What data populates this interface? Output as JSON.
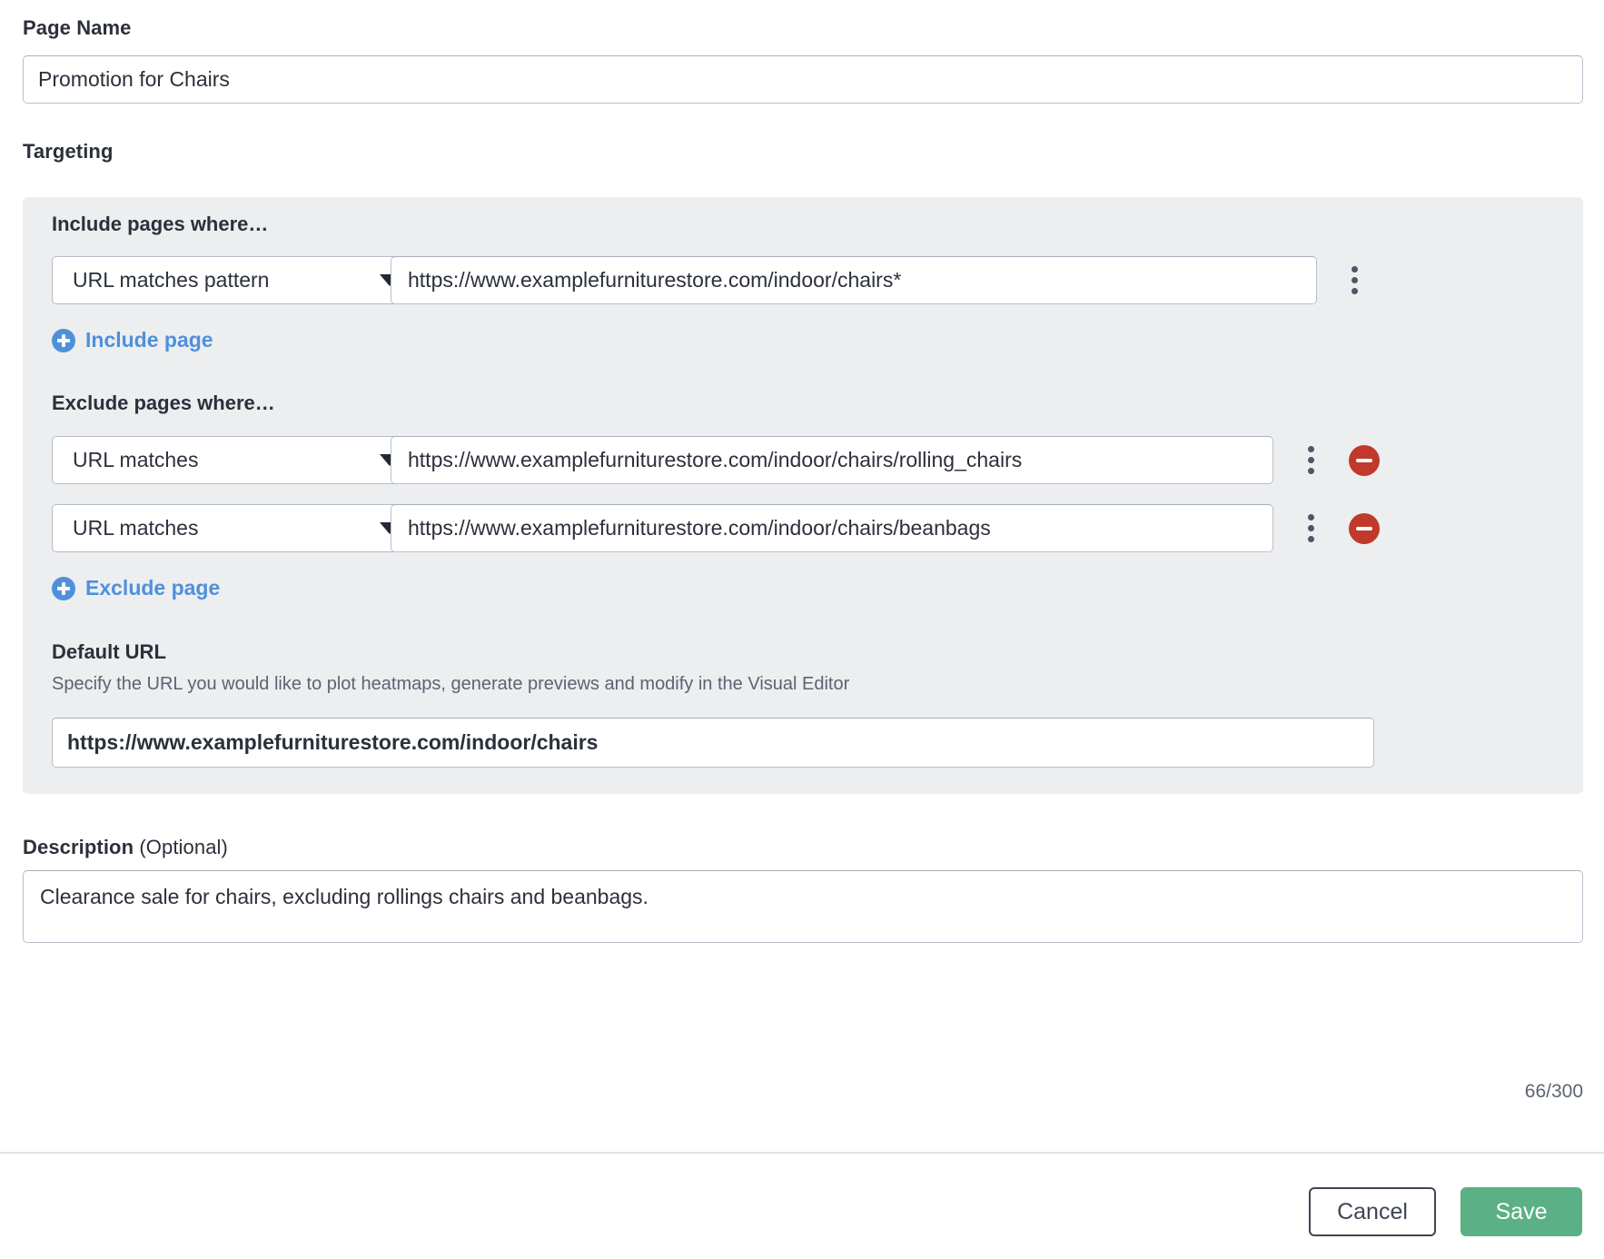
{
  "page_name": {
    "label": "Page Name",
    "value": "Promotion for Chairs"
  },
  "targeting": {
    "label": "Targeting",
    "include": {
      "heading": "Include pages where…",
      "rows": [
        {
          "condition": "URL matches pattern",
          "url": "https://www.examplefurniturestore.com/indoor/chairs*",
          "menu_icon": "kebab-menu-icon"
        }
      ],
      "add_label": "Include page",
      "add_icon": "plus-circle-icon"
    },
    "exclude": {
      "heading": "Exclude pages where…",
      "rows": [
        {
          "condition": "URL matches",
          "url": "https://www.examplefurniturestore.com/indoor/chairs/rolling_chairs",
          "menu_icon": "kebab-menu-icon",
          "remove_icon": "remove-circle-icon"
        },
        {
          "condition": "URL matches",
          "url": "https://www.examplefurniturestore.com/indoor/chairs/beanbags",
          "menu_icon": "kebab-menu-icon",
          "remove_icon": "remove-circle-icon"
        }
      ],
      "add_label": "Exclude page",
      "add_icon": "plus-circle-icon"
    },
    "default_url": {
      "label": "Default URL",
      "help": "Specify the URL you would like to plot heatmaps, generate previews and modify in the Visual Editor",
      "value": "https://www.examplefurniturestore.com/indoor/chairs"
    }
  },
  "description": {
    "label": "Description ",
    "optional": "(Optional)",
    "value": "Clearance sale for chairs, excluding rollings chairs and beanbags.",
    "char_count": "66/300"
  },
  "footer": {
    "cancel_label": "Cancel",
    "save_label": "Save"
  },
  "colors": {
    "accent_link": "#4f90da",
    "save_button": "#5cb085",
    "remove_button": "#c0392b",
    "panel_background": "#eceef0",
    "text": "#2b303b"
  }
}
